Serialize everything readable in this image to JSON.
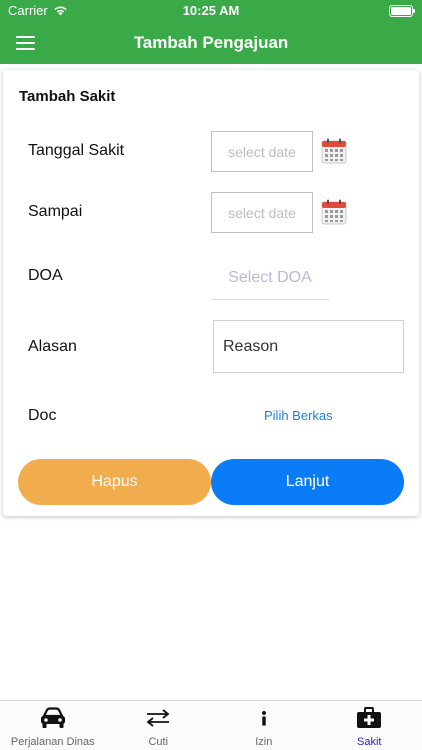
{
  "status_bar": {
    "carrier": "Carrier",
    "time": "10:25 AM"
  },
  "nav": {
    "title": "Tambah Pengajuan"
  },
  "form": {
    "title": "Tambah Sakit",
    "tanggal_sakit_label": "Tanggal Sakit",
    "tanggal_sakit_placeholder": "select date",
    "sampai_label": "Sampai",
    "sampai_placeholder": "select date",
    "doa_label": "DOA",
    "doa_placeholder": "Select DOA",
    "alasan_label": "Alasan",
    "alasan_placeholder": "Reason",
    "doc_label": "Doc",
    "doc_link": "Pilih Berkas",
    "delete_button": "Hapus",
    "next_button": "Lanjut"
  },
  "tabs": [
    {
      "label": "Perjalanan Dinas",
      "icon": "car-icon"
    },
    {
      "label": "Cuti",
      "icon": "swap-arrows-icon"
    },
    {
      "label": "Izin",
      "icon": "info-icon"
    },
    {
      "label": "Sakit",
      "icon": "medical-kit-icon",
      "active": true
    }
  ],
  "colors": {
    "primary_green": "#3aaa48",
    "delete_orange": "#f0ac4d",
    "next_blue": "#0a7cf6",
    "active_tab": "#2424c8"
  }
}
